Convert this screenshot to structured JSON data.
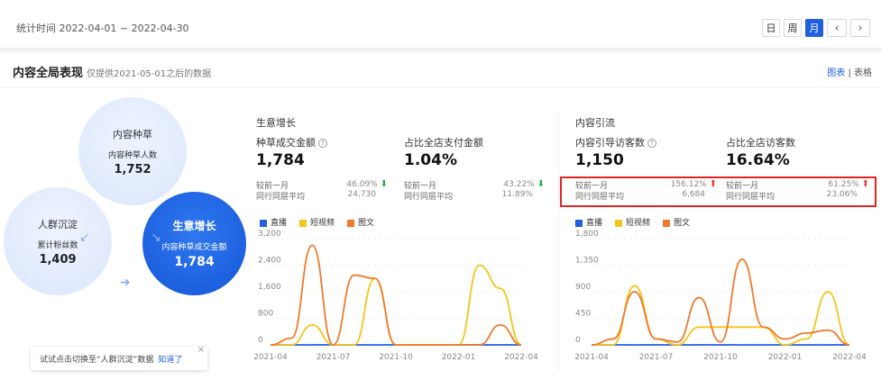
{
  "topbar": {
    "stat_label": "统计时间 2022-04-01 ~ 2022-04-30",
    "periods": [
      "日",
      "周",
      "月"
    ],
    "active_period": "月",
    "prev_icon": "chevron-left-icon",
    "next_icon": "chevron-right-icon"
  },
  "card": {
    "title": "内容全局表现",
    "subtitle": "仅提供2021-05-01之后的数据",
    "view_chart": "图表",
    "view_sep": "|",
    "view_table": "表格"
  },
  "funnel": {
    "seed": {
      "title": "内容种草",
      "label": "内容种草人数",
      "value": "1,752"
    },
    "fans": {
      "title": "人群沉淀",
      "label": "累计粉丝数",
      "value": "1,409"
    },
    "growth": {
      "title": "生意增长",
      "label": "内容种草成交金额",
      "value": "1,784"
    }
  },
  "hint": {
    "text": "试试点击切换至“人群沉淀”数据",
    "action": "知道了",
    "close": "×"
  },
  "growth_panel": {
    "section": "生意增长",
    "m1": {
      "label": "种草成交金额",
      "value": "1,784",
      "cmp1_label": "较前一月",
      "cmp1_value": "46.09%",
      "cmp2_label": "同行同层平均",
      "cmp2_value": "24,730"
    },
    "m2": {
      "label": "占比全店支付金额",
      "value": "1.04%",
      "cmp1_label": "较前一月",
      "cmp1_value": "43.22%",
      "cmp2_label": "同行同层平均",
      "cmp2_value": "11.89%"
    }
  },
  "traffic_panel": {
    "section": "内容引流",
    "m1": {
      "label": "内容引导访客数",
      "value": "1,150",
      "cmp1_label": "较前一月",
      "cmp1_value": "156.12%",
      "cmp2_label": "同行同层平均",
      "cmp2_value": "6,684"
    },
    "m2": {
      "label": "占比全店访客数",
      "value": "16.64%",
      "cmp1_label": "较前一月",
      "cmp1_value": "61.25%",
      "cmp2_label": "同行同层平均",
      "cmp2_value": "23.06%"
    }
  },
  "legend": [
    {
      "name": "直播",
      "color": "#1f5fe0"
    },
    {
      "name": "短视频",
      "color": "#f2c619"
    },
    {
      "name": "图文",
      "color": "#f07a2b"
    }
  ],
  "chart_data": [
    {
      "type": "line",
      "x": [
        "2021-04",
        "2021-05",
        "2021-06",
        "2021-07",
        "2021-08",
        "2021-09",
        "2021-10",
        "2021-11",
        "2021-12",
        "2022-01",
        "2022-02",
        "2022-03",
        "2022-04"
      ],
      "x_ticks": [
        "2021-04",
        "2021-07",
        "2021-10",
        "2022-01",
        "2022-04"
      ],
      "y_ticks": [
        "0",
        "800",
        "1,600",
        "2,400",
        "3,200"
      ],
      "ylim": [
        0,
        3200
      ],
      "series": [
        {
          "name": "直播",
          "color": "#1f5fe0",
          "values": [
            0,
            0,
            0,
            0,
            0,
            0,
            0,
            0,
            0,
            0,
            0,
            0,
            0
          ]
        },
        {
          "name": "短视频",
          "color": "#f2c619",
          "values": [
            0,
            0,
            600,
            0,
            0,
            2000,
            0,
            0,
            0,
            0,
            2400,
            1700,
            0
          ]
        },
        {
          "name": "图文",
          "color": "#f07a2b",
          "values": [
            0,
            200,
            3000,
            0,
            2100,
            2000,
            0,
            0,
            0,
            0,
            0,
            600,
            0
          ]
        }
      ]
    },
    {
      "type": "line",
      "x": [
        "2021-04",
        "2021-05",
        "2021-06",
        "2021-07",
        "2021-08",
        "2021-09",
        "2021-10",
        "2021-11",
        "2021-12",
        "2022-01",
        "2022-02",
        "2022-03",
        "2022-04"
      ],
      "x_ticks": [
        "2021-04",
        "2021-07",
        "2021-10",
        "2022-01",
        "2022-04"
      ],
      "y_ticks": [
        "0",
        "450",
        "900",
        "1,350",
        "1,800"
      ],
      "ylim": [
        0,
        1800
      ],
      "series": [
        {
          "name": "直播",
          "color": "#1f5fe0",
          "values": [
            0,
            0,
            0,
            0,
            0,
            0,
            0,
            0,
            0,
            0,
            0,
            0,
            0
          ]
        },
        {
          "name": "短视频",
          "color": "#f2c619",
          "values": [
            0,
            0,
            1000,
            100,
            0,
            300,
            300,
            300,
            300,
            0,
            100,
            900,
            0
          ]
        },
        {
          "name": "图文",
          "color": "#f07a2b",
          "values": [
            0,
            100,
            900,
            100,
            50,
            800,
            50,
            1450,
            300,
            100,
            200,
            250,
            0
          ]
        }
      ]
    }
  ]
}
